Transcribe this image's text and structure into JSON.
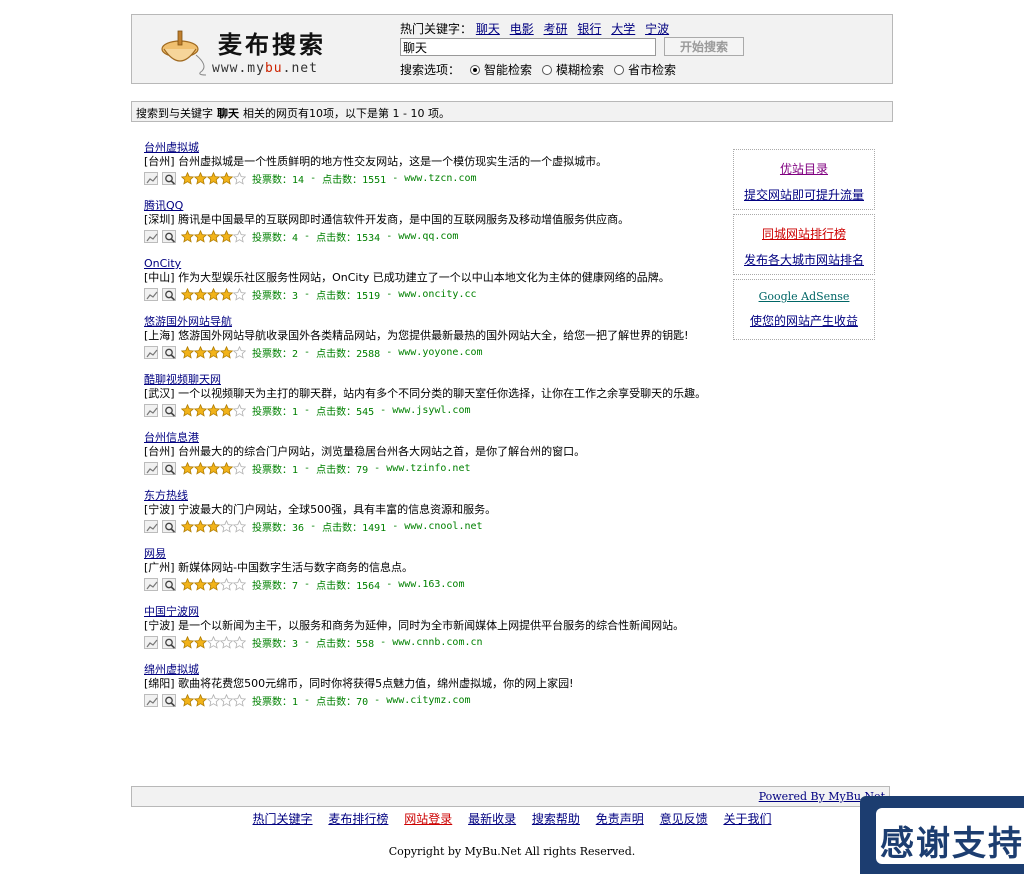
{
  "logo": {
    "title": "麦布搜索",
    "url_pre": "www.my",
    "url_mid": "bu",
    "url_post": ".net"
  },
  "header": {
    "hot_label": "热门关键字：",
    "hot_keywords": [
      "聊天",
      "电影",
      "考研",
      "银行",
      "大学",
      "宁波"
    ],
    "search_value": "聊天",
    "search_button": "开始搜索",
    "options_label": "搜索选项：",
    "options": [
      "智能检索",
      "模糊检索",
      "省市检索"
    ],
    "selected_option": 0
  },
  "result_bar": {
    "pre": "搜索到与关键字",
    "keyword": "聊天",
    "post": "相关的网页有10项，以下是第 1 - 10 项。"
  },
  "results": [
    {
      "title": "台州虚拟城",
      "desc": "[台州] 台州虚拟城是一个性质鲜明的地方性交友网站，这是一个模仿现实生活的一个虚拟城市。",
      "rating": 4,
      "votes": "投票数：14",
      "clicks": "点击数：1551",
      "url": "www.tzcn.com"
    },
    {
      "title": "腾讯QQ",
      "desc": "[深圳] 腾讯是中国最早的互联网即时通信软件开发商，是中国的互联网服务及移动增值服务供应商。",
      "rating": 4,
      "votes": "投票数：4",
      "clicks": "点击数：1534",
      "url": "www.qq.com"
    },
    {
      "title": "OnCity",
      "desc": "[中山] 作为大型娱乐社区服务性网站，OnCity 已成功建立了一个以中山本地文化为主体的健康网络的品牌。",
      "rating": 4,
      "votes": "投票数：3",
      "clicks": "点击数：1519",
      "url": "www.oncity.cc"
    },
    {
      "title": "悠游国外网站导航",
      "desc": "[上海] 悠游国外网站导航收录国外各类精品网站，为您提供最新最热的国外网站大全，给您一把了解世界的钥匙!",
      "rating": 4,
      "votes": "投票数：2",
      "clicks": "点击数：2588",
      "url": "www.yoyone.com"
    },
    {
      "title": "酷聊视频聊天网",
      "desc": "[武汉] 一个以视频聊天为主打的聊天群，站内有多个不同分类的聊天室任你选择，让你在工作之余享受聊天的乐趣。",
      "rating": 4,
      "votes": "投票数：1",
      "clicks": "点击数：545",
      "url": "www.jsywl.com"
    },
    {
      "title": "台州信息港",
      "desc": "[台州] 台州最大的的综合门户网站，浏览量稳居台州各大网站之首，是你了解台州的窗口。",
      "rating": 4,
      "votes": "投票数：1",
      "clicks": "点击数：79",
      "url": "www.tzinfo.net"
    },
    {
      "title": "东方热线",
      "desc": "[宁波] 宁波最大的门户网站，全球500强，具有丰富的信息资源和服务。",
      "rating": 3,
      "votes": "投票数：36",
      "clicks": "点击数：1491",
      "url": "www.cnool.net"
    },
    {
      "title": "网易",
      "desc": "[广州] 新媒体网站-中国数字生活与数字商务的信息点。",
      "rating": 3,
      "votes": "投票数：7",
      "clicks": "点击数：1564",
      "url": "www.163.com"
    },
    {
      "title": "中国宁波网",
      "desc": "[宁波] 是一个以新闻为主干，以服务和商务为延伸，同时为全市新闻媒体上网提供平台服务的综合性新闻网站。",
      "rating": 2,
      "votes": "投票数：3",
      "clicks": "点击数：558",
      "url": "www.cnnb.com.cn"
    },
    {
      "title": "绵州虚拟城",
      "desc": "[绵阳] 歌曲将花费您500元绵币，同时你将获得5点魅力值，绵州虚拟城，你的网上家园!",
      "rating": 2,
      "votes": "投票数：1",
      "clicks": "点击数：70",
      "url": "www.citymz.com"
    }
  ],
  "sidebar": [
    {
      "l1": "优站目录",
      "l2": "提交网站即可提升流量"
    },
    {
      "l1": "同城网站排行榜",
      "l2": "发布各大城市网站排名"
    },
    {
      "l1": "Google AdSense",
      "l2": "使您的网站产生收益"
    }
  ],
  "footer": {
    "powered": "Powered By MyBu.Net",
    "links": [
      "热门关键字",
      "麦布排行榜",
      "网站登录",
      "最新收录",
      "搜索帮助",
      "免责声明",
      "意见反馈",
      "关于我们"
    ],
    "copyright": "Copyright by MyBu.Net All rights Reserved."
  },
  "thanks": "感谢支持"
}
